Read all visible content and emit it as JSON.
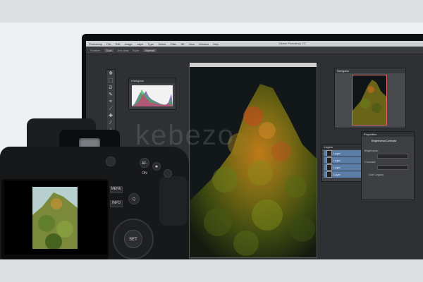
{
  "app": {
    "menu_items": [
      "Photoshop",
      "File",
      "Edit",
      "Image",
      "Layer",
      "Type",
      "Select",
      "Filter",
      "3D",
      "View",
      "Window",
      "Help"
    ],
    "title": "Adobe Photoshop CC"
  },
  "options_bar": {
    "items": [
      "Feather:",
      "0 px",
      "Anti-alias",
      "Style:",
      "Normal"
    ]
  },
  "tools": {
    "icons": [
      "move-icon",
      "marquee-icon",
      "lasso-icon",
      "quick-select-icon",
      "crop-icon",
      "eyedropper-icon",
      "healing-icon",
      "brush-icon",
      "clone-icon",
      "history-brush-icon",
      "eraser-icon",
      "gradient-icon",
      "blur-icon",
      "dodge-icon",
      "pen-icon",
      "type-icon",
      "path-select-icon",
      "shape-icon",
      "hand-icon",
      "zoom-icon"
    ]
  },
  "histogram": {
    "title": "Histogram"
  },
  "navigator": {
    "title": "Navigator"
  },
  "layers": {
    "title": "Layers",
    "rows": [
      "Layer",
      "Layer",
      "Layer",
      "Layer"
    ]
  },
  "properties": {
    "title": "Properties",
    "subtitle": "Brightness/Contrast",
    "fields": [
      "Brightness:",
      "Contrast:",
      "Use Legacy"
    ]
  },
  "camera": {
    "buttons": {
      "menu": "MENU",
      "info": "INFO",
      "q": "Q",
      "set": "SET",
      "af_on": "AF-ON",
      "star": "✱"
    }
  },
  "watermark": "kebezo",
  "colors": {
    "accent_layer": "#5b7ea8",
    "navigator_frame": "#e46a6a"
  }
}
